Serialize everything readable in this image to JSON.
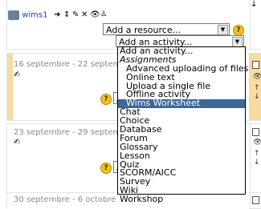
{
  "resource_row": {
    "module_name": "wims1",
    "add_resource": "Add a resource...",
    "add_activity": "Add an activity..."
  },
  "sections": [
    {
      "dates": "16 septembre - 22 septembre",
      "add_trunc": "Ad"
    },
    {
      "dates": "23 septembre - 29 septembre",
      "add_trunc": "Ad"
    },
    {
      "dates": "30 septembre - 6 octobre"
    }
  ],
  "help_glyph": "?",
  "dropdown": {
    "options": [
      {
        "label": "Add an activity...",
        "kind": "plain"
      },
      {
        "label": "Assignments",
        "kind": "group"
      },
      {
        "label": "Advanced uploading of files",
        "kind": "indent"
      },
      {
        "label": "Online text",
        "kind": "indent"
      },
      {
        "label": "Upload a single file",
        "kind": "indent"
      },
      {
        "label": "Offline activity",
        "kind": "indent"
      },
      {
        "label": "Wims Worksheet",
        "kind": "indent",
        "selected": true
      },
      {
        "label": "Chat",
        "kind": "plain"
      },
      {
        "label": "Choice",
        "kind": "plain"
      },
      {
        "label": "Database",
        "kind": "plain"
      },
      {
        "label": "Forum",
        "kind": "plain"
      },
      {
        "label": "Glossary",
        "kind": "plain"
      },
      {
        "label": "Lesson",
        "kind": "plain"
      },
      {
        "label": "Quiz",
        "kind": "plain"
      },
      {
        "label": "SCORM/AICC",
        "kind": "plain"
      },
      {
        "label": "Survey",
        "kind": "plain"
      },
      {
        "label": "Wiki",
        "kind": "plain"
      },
      {
        "label": "Workshop",
        "kind": "plain"
      }
    ]
  },
  "colors": {
    "highlight": "#3c6896",
    "current_week": "#f7dba0",
    "help": "#f2c21b"
  }
}
